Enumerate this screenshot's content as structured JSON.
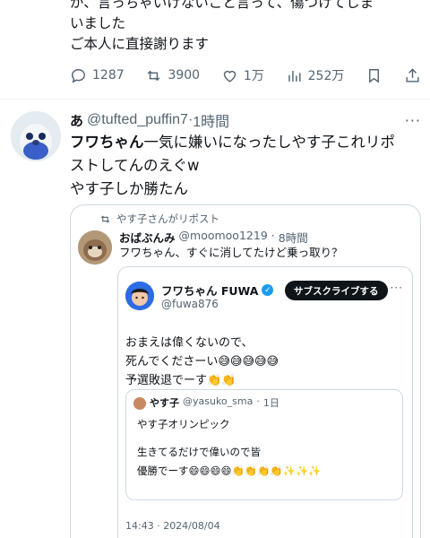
{
  "previous_tweet": {
    "lines": [
      "が、言っちゃいけないこと言って、傷つけてしま",
      "いました",
      "ご本人に直接謝ります"
    ],
    "actions": {
      "replies": "1287",
      "reposts": "3900",
      "likes": "1万",
      "views": "252万"
    }
  },
  "tweet": {
    "name": "あ",
    "handle": "@tufted_puffin7",
    "dot": "·",
    "time": "1時間",
    "more": "···",
    "mention": "フワちゃん",
    "text_line1_rest": "一気に嫌いになったしやす子これリポ",
    "text_line2": "ストしてんのえぐw",
    "text_line3": "やす子しか勝たん"
  },
  "quote": {
    "repost_label": "やす子さんがリポスト",
    "name": "おばぶんみ",
    "handle": "@moomoo1219",
    "time": "8時間",
    "text": "フワちゃん、すぐに消してたけど乗っ取り？",
    "inner": {
      "name": "フワちゃん FUWA",
      "handle": "@fuwa876",
      "subscribe_label": "サブスクライブする",
      "more": "···",
      "line1": "おまえは偉くないので、",
      "line2": "死んでくださーい😅😅😅😅😅",
      "line3": "予選敗退でーす👏👏",
      "nested": {
        "name": "やす子",
        "handle": "@yasuko_sma",
        "time": "1日",
        "line1": "やす子オリンピック",
        "line2": "生きてるだけで偉いので皆",
        "line3": "優勝でーす😄😄😄😄👏👏👏👏✨✨✨"
      },
      "timestamp": "14:43 · 2024/08/04"
    }
  }
}
